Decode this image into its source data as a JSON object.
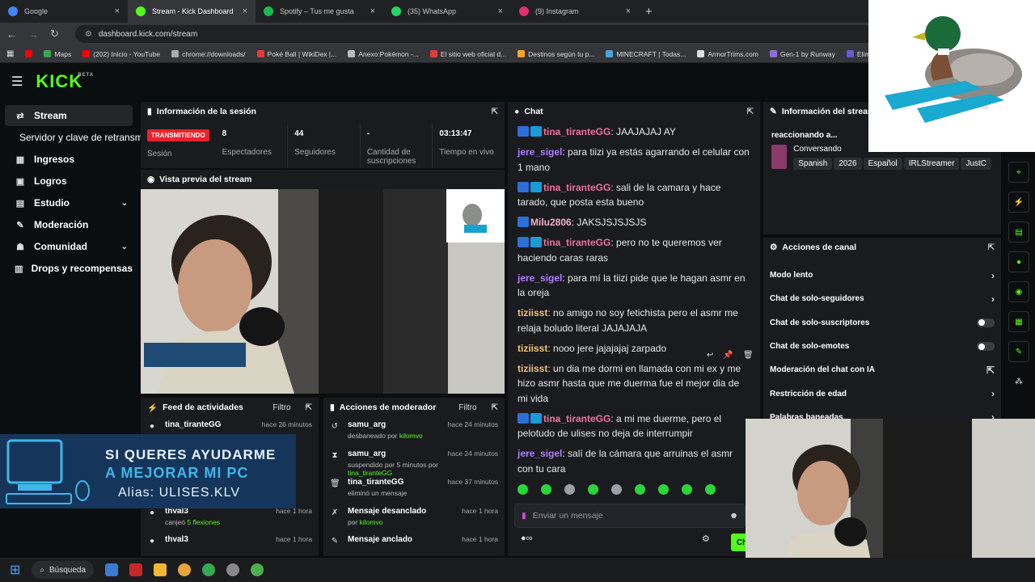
{
  "browser": {
    "tabs": [
      {
        "title": "Google",
        "color": "#4285f4",
        "active": false
      },
      {
        "title": "Stream - Kick Dashboard",
        "color": "#53fc18",
        "active": true
      },
      {
        "title": "Spotify – Tus me gusta",
        "color": "#1db954",
        "active": false
      },
      {
        "title": "(35) WhatsApp",
        "color": "#25d366",
        "active": false
      },
      {
        "title": "(9) Instagram",
        "color": "#e1306c",
        "active": false
      }
    ],
    "new_tab": "+",
    "url": "dashboard.kick.com/stream",
    "bookmarks": [
      {
        "label": "Maps",
        "color": "#34a853"
      },
      {
        "label": "(202) Inicio - YouTube",
        "color": "#ff0000"
      },
      {
        "label": "chrome://downloads/",
        "color": "#aaaaaa"
      },
      {
        "label": "Poké Ball | WikiDex |...",
        "color": "#e53935"
      },
      {
        "label": "Anexo:Pokémon -...",
        "color": "#bbbbbb"
      },
      {
        "label": "El sitio web oficial d...",
        "color": "#e53935"
      },
      {
        "label": "Destinos según tu p...",
        "color": "#f5a623"
      },
      {
        "label": "MINECRAFT | Todas...",
        "color": "#4aa3df"
      },
      {
        "label": "ArmorTrims.com",
        "color": "#dddddd"
      },
      {
        "label": "Gen-1 by Runway",
        "color": "#8e6bd8"
      },
      {
        "label": "Eliminador d",
        "color": "#6a5acd"
      }
    ]
  },
  "sidebar": {
    "items": [
      {
        "label": "Stream",
        "icon": "⇄",
        "active": true
      },
      {
        "label": "Servidor y clave de retransmisión",
        "sub": true
      },
      {
        "label": "Ingresos",
        "icon": "▦"
      },
      {
        "label": "Logros",
        "icon": "▣"
      },
      {
        "label": "Estudio",
        "icon": "▤",
        "chevron": "⌄"
      },
      {
        "label": "Moderación",
        "icon": "✎"
      },
      {
        "label": "Comunidad",
        "icon": "☗",
        "chevron": "⌄"
      },
      {
        "label": "Drops y recompensas",
        "icon": "▥"
      }
    ]
  },
  "session": {
    "title": "Información de la sesión",
    "live_badge": "TRANSMITIENDO",
    "session_label": "Sesión",
    "stats": [
      {
        "value": "8",
        "label": "Espectadores"
      },
      {
        "value": "44",
        "label": "Seguidores"
      },
      {
        "value": "-",
        "label": "Cantidad de suscripciones"
      },
      {
        "value": "03:13:47",
        "label": "Tiempo en vivo"
      }
    ]
  },
  "preview": {
    "title": "Vista previa del stream"
  },
  "feed": {
    "title": "Feed de actividades",
    "filter": "Filtro",
    "items": [
      {
        "name": "tina_tiranteGG",
        "time": "hace 26 minutos",
        "sub_pre": "",
        "sub_hl": ""
      },
      {
        "name": "",
        "time": "",
        "sub_pre": "",
        "sub_hl": ""
      },
      {
        "name": "",
        "time": "",
        "sub_pre": "",
        "sub_hl": ""
      },
      {
        "name": "thval3",
        "time": "hace 1 hora",
        "sub_pre": "canjeó ",
        "sub_hl": "5 flexiones"
      },
      {
        "name": "thval3",
        "time": "hace 1 hora",
        "sub_pre": "",
        "sub_hl": ""
      }
    ]
  },
  "modactions": {
    "title": "Acciones de moderador",
    "filter": "Filtro",
    "items": [
      {
        "icon": "↺",
        "name": "samu_arg",
        "time": "hace 24 minutos",
        "sub_pre": "desbaneado por ",
        "sub_hl": "kilomvo"
      },
      {
        "icon": "⧗",
        "name": "samu_arg",
        "time": "hace 24 minutos",
        "sub_pre": "suspendido por 5 minutos por ",
        "sub_hl": "tina_tiranteGG"
      },
      {
        "icon": "🗑",
        "name": "tina_tiranteGG",
        "time": "hace 37 minutos",
        "sub_pre": "eliminó un mensaje",
        "sub_hl": ""
      },
      {
        "icon": "✗",
        "name": "Mensaje desanclado",
        "time": "hace 1 hora",
        "sub_pre": "por ",
        "sub_hl": "kilomvo"
      },
      {
        "icon": "✎",
        "name": "Mensaje anclado",
        "time": "hace 1 hora",
        "sub_pre": "",
        "sub_hl": ""
      }
    ]
  },
  "chat": {
    "title": "Chat",
    "messages": [
      {
        "user": "tina_tiranteGG",
        "color": "pink",
        "badges": true,
        "text": "JAAJAJAJ AY"
      },
      {
        "user": "jere_sigel",
        "color": "purple",
        "badges": false,
        "text": "para tiizi ya estás agarrando el celular con 1 mano"
      },
      {
        "user": "tina_tiranteGG",
        "color": "pink",
        "badges": true,
        "text": "sali de la camara y hace tarado, que posta esta bueno"
      },
      {
        "user": "Milu2806",
        "color": "light",
        "badges": "one",
        "text": "JAKSJSJSJSJS"
      },
      {
        "user": "tina_tiranteGG",
        "color": "pink",
        "badges": true,
        "text": "pero no te queremos ver haciendo caras raras"
      },
      {
        "user": "jere_sigel",
        "color": "purple",
        "badges": false,
        "text": "para mí la tiizi pide que le hagan asmr en la oreja"
      },
      {
        "user": "tiziisst",
        "color": "orange",
        "badges": false,
        "text": "no amigo no soy fetichista pero el asmr me relaja boludo literal JAJAJAJA"
      },
      {
        "user": "tiziisst",
        "color": "orange",
        "badges": false,
        "text": "nooo jere jajajajaj zarpado"
      },
      {
        "user": "tiziisst",
        "color": "orange",
        "badges": false,
        "text": "un dia me dormi en llamada con mi ex y me hizo asmr hasta que me duerma fue el mejor dia de mi vida"
      },
      {
        "user": "tina_tiranteGG",
        "color": "pink",
        "badges": true,
        "text": "a mi me duerme, pero el pelotudo de ulises no deja de interrumpir"
      },
      {
        "user": "jere_sigel",
        "color": "purple",
        "badges": false,
        "text": "salí de la cámara que arruinas el asmr con tu cara"
      }
    ],
    "input_placeholder": "Enviar un mensaje",
    "send_label": "Chat"
  },
  "stream_info": {
    "title": "Información del stream",
    "stream_title": "reaccionando a...",
    "category": "Conversando",
    "tags": [
      "Spanish",
      "2026",
      "Español",
      "IRLStreamer",
      "JustC"
    ]
  },
  "channel_actions": {
    "title": "Acciones de canal",
    "rows": [
      {
        "label": "Modo lento",
        "kind": "chev"
      },
      {
        "label": "Chat de solo-seguidores",
        "kind": "chev"
      },
      {
        "label": "Chat de solo-suscriptores",
        "kind": "toggle"
      },
      {
        "label": "Chat de solo-emotes",
        "kind": "toggle"
      },
      {
        "label": "Moderación del chat con IA",
        "kind": "ext"
      },
      {
        "label": "Restricción de edad",
        "kind": "chev"
      },
      {
        "label": "Palabras baneadas",
        "kind": "chev"
      }
    ]
  },
  "donation": {
    "line1": "SI QUERES AYUDARME",
    "line2": "A MEJORAR MI PC",
    "line3": "Alias: ULISES.KLV"
  },
  "taskbar": {
    "search_label": "Búsqueda"
  },
  "colors": {
    "accent": "#53fc18",
    "live": "#e8232a",
    "panel": "#191b1f",
    "bg": "#0b0e0f"
  }
}
